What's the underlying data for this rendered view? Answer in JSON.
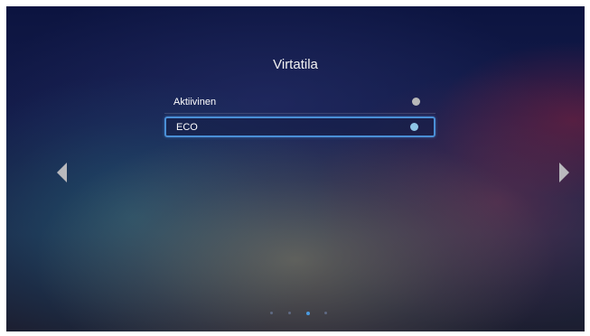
{
  "menu": {
    "title": "Virtatila",
    "options": [
      {
        "label": "Aktiivinen",
        "selected": false
      },
      {
        "label": "ECO",
        "selected": true
      }
    ]
  },
  "navigation": {
    "left_arrow_icon": "triangle-left-icon",
    "right_arrow_icon": "triangle-right-icon",
    "page_indicator": {
      "pages": 4,
      "current": 3
    }
  },
  "colors": {
    "highlight": "#4a8fd6",
    "selected_radio": "#8ec5e6",
    "radio": "#b8b8b8",
    "arrow": "#b9b9bd"
  }
}
